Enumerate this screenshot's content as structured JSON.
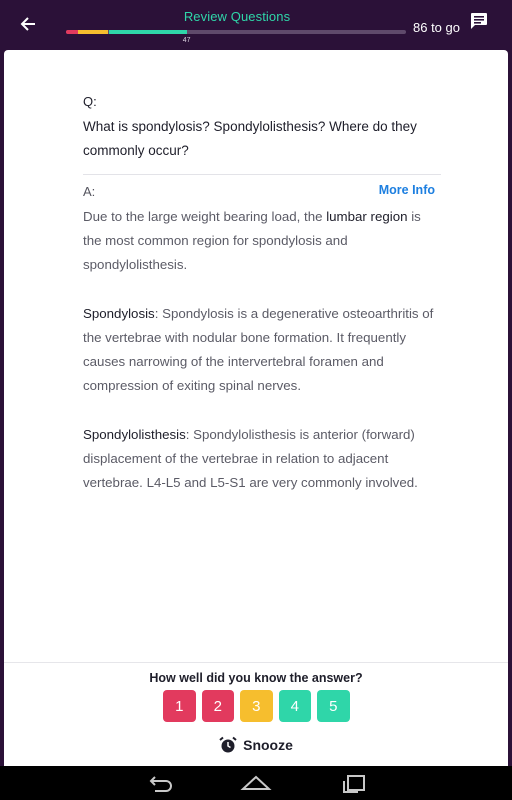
{
  "header": {
    "title": "Review Questions",
    "progress_count": "47",
    "remaining": "86 to go",
    "progress_segments": [
      {
        "color": "#e23a5e",
        "fraction": 0.035
      },
      {
        "color": "#f6be2e",
        "fraction": 0.09
      },
      {
        "color": "#2fd6a9",
        "fraction": 0.23
      }
    ]
  },
  "question": {
    "label": "Q:",
    "text": "What is spondylosis? Spondylolisthesis? Where do they commonly occur?"
  },
  "answer": {
    "label": "A:",
    "more_info": "More Info",
    "p1_pre": "Due to the large weight bearing load, the ",
    "p1_em": "lumbar region",
    "p1_post": " is the most common region for spondylosis and spondylolisthesis.",
    "p2_em": "Spondylosis",
    "p2_post": ": Spondylosis is a degenerative osteoarthritis of the vertebrae with nodular bone formation. It frequently causes narrowing of the intervertebral foramen and compression of exiting spinal nerves.",
    "p3_em": "Spondylolisthesis",
    "p3_post": ": Spondylolisthesis is anterior (forward) displacement of the vertebrae in relation to adjacent vertebrae. L4-L5 and L5-S1 are very commonly involved."
  },
  "rating": {
    "prompt": "How well did you know the answer?",
    "buttons": [
      {
        "label": "1",
        "color": "#e23a5e"
      },
      {
        "label": "2",
        "color": "#e23a5e"
      },
      {
        "label": "3",
        "color": "#f6be2e"
      },
      {
        "label": "4",
        "color": "#2fd6a9"
      },
      {
        "label": "5",
        "color": "#2fd6a9"
      }
    ]
  },
  "snooze": {
    "label": "Snooze",
    "icon": "alarm-clock-icon"
  },
  "navigation": {
    "icons": [
      "back-nav-icon",
      "home-nav-icon",
      "recents-nav-icon"
    ]
  }
}
